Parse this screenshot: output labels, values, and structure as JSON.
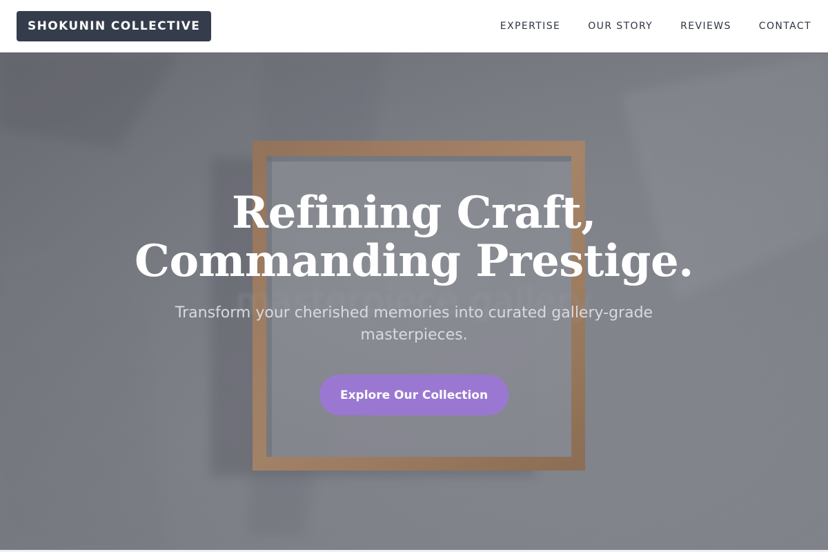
{
  "header": {
    "brand": "SHOKUNIN COLLECTIVE",
    "nav": [
      {
        "label": "EXPERTISE"
      },
      {
        "label": "OUR STORY"
      },
      {
        "label": "REVIEWS"
      },
      {
        "label": "CONTACT"
      }
    ]
  },
  "hero": {
    "title_line_1": "Refining Craft,",
    "title_line_2": "Commanding Prestige.",
    "subtitle": "Transform your cherished memories into curated gallery-grade masterpieces.",
    "cta_label": "Explore Our Collection"
  },
  "colors": {
    "header_background": "#ffffff",
    "brand_background": "#353d4c",
    "nav_text": "#2e3440",
    "cta_background": "#9a78d2",
    "hero_text": "#ffffff",
    "frame_wood": "#a57f5f"
  }
}
